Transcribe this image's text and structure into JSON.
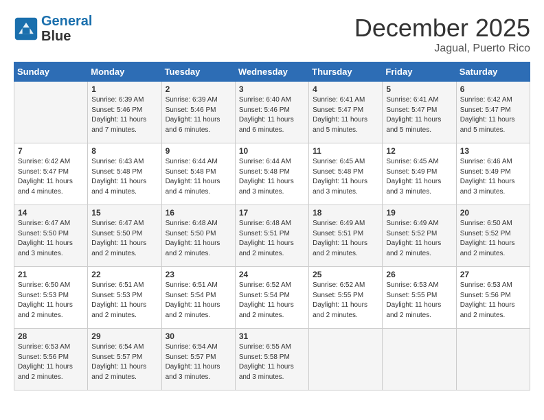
{
  "header": {
    "logo_line1": "General",
    "logo_line2": "Blue",
    "month": "December 2025",
    "location": "Jagual, Puerto Rico"
  },
  "days_of_week": [
    "Sunday",
    "Monday",
    "Tuesday",
    "Wednesday",
    "Thursday",
    "Friday",
    "Saturday"
  ],
  "weeks": [
    [
      {
        "day": "",
        "info": ""
      },
      {
        "day": "1",
        "info": "Sunrise: 6:39 AM\nSunset: 5:46 PM\nDaylight: 11 hours\nand 7 minutes."
      },
      {
        "day": "2",
        "info": "Sunrise: 6:39 AM\nSunset: 5:46 PM\nDaylight: 11 hours\nand 6 minutes."
      },
      {
        "day": "3",
        "info": "Sunrise: 6:40 AM\nSunset: 5:46 PM\nDaylight: 11 hours\nand 6 minutes."
      },
      {
        "day": "4",
        "info": "Sunrise: 6:41 AM\nSunset: 5:47 PM\nDaylight: 11 hours\nand 5 minutes."
      },
      {
        "day": "5",
        "info": "Sunrise: 6:41 AM\nSunset: 5:47 PM\nDaylight: 11 hours\nand 5 minutes."
      },
      {
        "day": "6",
        "info": "Sunrise: 6:42 AM\nSunset: 5:47 PM\nDaylight: 11 hours\nand 5 minutes."
      }
    ],
    [
      {
        "day": "7",
        "info": "Sunrise: 6:42 AM\nSunset: 5:47 PM\nDaylight: 11 hours\nand 4 minutes."
      },
      {
        "day": "8",
        "info": "Sunrise: 6:43 AM\nSunset: 5:48 PM\nDaylight: 11 hours\nand 4 minutes."
      },
      {
        "day": "9",
        "info": "Sunrise: 6:44 AM\nSunset: 5:48 PM\nDaylight: 11 hours\nand 4 minutes."
      },
      {
        "day": "10",
        "info": "Sunrise: 6:44 AM\nSunset: 5:48 PM\nDaylight: 11 hours\nand 3 minutes."
      },
      {
        "day": "11",
        "info": "Sunrise: 6:45 AM\nSunset: 5:48 PM\nDaylight: 11 hours\nand 3 minutes."
      },
      {
        "day": "12",
        "info": "Sunrise: 6:45 AM\nSunset: 5:49 PM\nDaylight: 11 hours\nand 3 minutes."
      },
      {
        "day": "13",
        "info": "Sunrise: 6:46 AM\nSunset: 5:49 PM\nDaylight: 11 hours\nand 3 minutes."
      }
    ],
    [
      {
        "day": "14",
        "info": "Sunrise: 6:47 AM\nSunset: 5:50 PM\nDaylight: 11 hours\nand 3 minutes."
      },
      {
        "day": "15",
        "info": "Sunrise: 6:47 AM\nSunset: 5:50 PM\nDaylight: 11 hours\nand 2 minutes."
      },
      {
        "day": "16",
        "info": "Sunrise: 6:48 AM\nSunset: 5:50 PM\nDaylight: 11 hours\nand 2 minutes."
      },
      {
        "day": "17",
        "info": "Sunrise: 6:48 AM\nSunset: 5:51 PM\nDaylight: 11 hours\nand 2 minutes."
      },
      {
        "day": "18",
        "info": "Sunrise: 6:49 AM\nSunset: 5:51 PM\nDaylight: 11 hours\nand 2 minutes."
      },
      {
        "day": "19",
        "info": "Sunrise: 6:49 AM\nSunset: 5:52 PM\nDaylight: 11 hours\nand 2 minutes."
      },
      {
        "day": "20",
        "info": "Sunrise: 6:50 AM\nSunset: 5:52 PM\nDaylight: 11 hours\nand 2 minutes."
      }
    ],
    [
      {
        "day": "21",
        "info": "Sunrise: 6:50 AM\nSunset: 5:53 PM\nDaylight: 11 hours\nand 2 minutes."
      },
      {
        "day": "22",
        "info": "Sunrise: 6:51 AM\nSunset: 5:53 PM\nDaylight: 11 hours\nand 2 minutes."
      },
      {
        "day": "23",
        "info": "Sunrise: 6:51 AM\nSunset: 5:54 PM\nDaylight: 11 hours\nand 2 minutes."
      },
      {
        "day": "24",
        "info": "Sunrise: 6:52 AM\nSunset: 5:54 PM\nDaylight: 11 hours\nand 2 minutes."
      },
      {
        "day": "25",
        "info": "Sunrise: 6:52 AM\nSunset: 5:55 PM\nDaylight: 11 hours\nand 2 minutes."
      },
      {
        "day": "26",
        "info": "Sunrise: 6:53 AM\nSunset: 5:55 PM\nDaylight: 11 hours\nand 2 minutes."
      },
      {
        "day": "27",
        "info": "Sunrise: 6:53 AM\nSunset: 5:56 PM\nDaylight: 11 hours\nand 2 minutes."
      }
    ],
    [
      {
        "day": "28",
        "info": "Sunrise: 6:53 AM\nSunset: 5:56 PM\nDaylight: 11 hours\nand 2 minutes."
      },
      {
        "day": "29",
        "info": "Sunrise: 6:54 AM\nSunset: 5:57 PM\nDaylight: 11 hours\nand 2 minutes."
      },
      {
        "day": "30",
        "info": "Sunrise: 6:54 AM\nSunset: 5:57 PM\nDaylight: 11 hours\nand 3 minutes."
      },
      {
        "day": "31",
        "info": "Sunrise: 6:55 AM\nSunset: 5:58 PM\nDaylight: 11 hours\nand 3 minutes."
      },
      {
        "day": "",
        "info": ""
      },
      {
        "day": "",
        "info": ""
      },
      {
        "day": "",
        "info": ""
      }
    ]
  ]
}
